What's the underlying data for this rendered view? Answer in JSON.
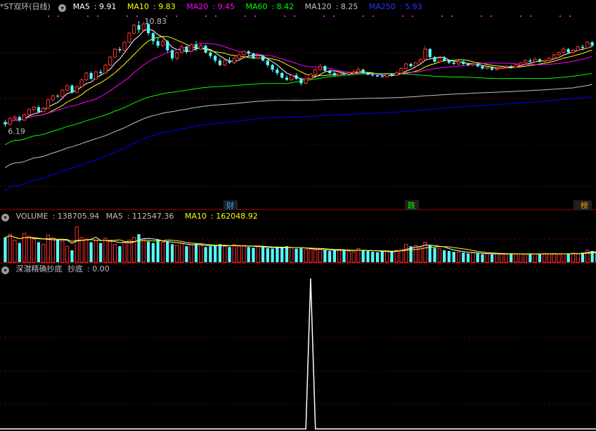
{
  "panels": {
    "price": {
      "title": "*ST双环(日线)",
      "ma_labels": [
        {
          "name": "MA5",
          "value": "9.91",
          "color": "#ffffff"
        },
        {
          "name": "MA10",
          "value": "9.83",
          "color": "#ffff00"
        },
        {
          "name": "MA20",
          "value": "9.45",
          "color": "#ff00ff"
        },
        {
          "name": "MA60",
          "value": "8.42",
          "color": "#00ff00"
        },
        {
          "name": "MA120",
          "value": "8.25",
          "color": "#c0c0c0"
        },
        {
          "name": "MA250",
          "value": "5.93",
          "color": "#0000ff"
        }
      ],
      "high_label": "10.83",
      "low_label": "6.19",
      "event_markers": [
        {
          "text": "财",
          "color": "#3399ff"
        },
        {
          "text": "跌",
          "color": "#00ff00"
        },
        {
          "text": "榜",
          "color": "#ff9900"
        }
      ]
    },
    "volume": {
      "title": "VOLUME",
      "value": "138705.94",
      "ma5_label": "MA5",
      "ma5_value": "112547.36",
      "ma10_label": "MA10",
      "ma10_value": "162048.92"
    },
    "indicator": {
      "title": "深潜精确抄底",
      "series_label": "抄底",
      "value": "0.00"
    }
  },
  "colors": {
    "up": "#ff3232",
    "down": "#54ffff",
    "grid": "#7a0000",
    "separator": "#b00000",
    "ma5": "#ffffff",
    "ma10": "#ffff00",
    "ma20": "#ff00ff",
    "ma60": "#00ff00",
    "ma120": "#c0c0c0",
    "ma250": "#0000ff",
    "indicator_line": "#ffffff"
  },
  "chart_data": {
    "type": "candlestick",
    "price_range": [
      5.8,
      11.2
    ],
    "candles": [
      [
        6.4,
        6.3,
        6.19,
        6.5
      ],
      [
        6.3,
        6.55,
        6.25,
        6.62
      ],
      [
        6.55,
        6.62,
        6.48,
        6.7
      ],
      [
        6.62,
        6.48,
        6.4,
        6.68
      ],
      [
        6.48,
        6.72,
        6.45,
        6.78
      ],
      [
        6.72,
        6.95,
        6.7,
        7.0
      ],
      [
        6.95,
        7.05,
        6.88,
        7.1
      ],
      [
        7.05,
        6.85,
        6.8,
        7.12
      ],
      [
        6.85,
        7.0,
        6.82,
        7.08
      ],
      [
        7.0,
        7.38,
        6.98,
        7.42
      ],
      [
        7.38,
        7.55,
        7.3,
        7.6
      ],
      [
        7.55,
        7.52,
        7.45,
        7.62
      ],
      [
        7.52,
        7.8,
        7.5,
        7.85
      ],
      [
        7.8,
        8.0,
        7.75,
        8.05
      ],
      [
        8.0,
        7.7,
        7.65,
        8.05
      ],
      [
        7.7,
        7.95,
        7.68,
        8.0
      ],
      [
        7.95,
        8.25,
        7.9,
        8.3
      ],
      [
        8.25,
        8.55,
        8.2,
        8.6
      ],
      [
        8.55,
        8.3,
        8.25,
        8.62
      ],
      [
        8.3,
        8.6,
        8.28,
        8.65
      ],
      [
        8.6,
        8.55,
        8.45,
        8.7
      ],
      [
        8.55,
        8.9,
        8.5,
        8.95
      ],
      [
        8.9,
        9.25,
        8.85,
        9.3
      ],
      [
        9.25,
        9.6,
        9.2,
        9.65
      ],
      [
        9.6,
        9.55,
        9.45,
        9.7
      ],
      [
        9.55,
        9.9,
        9.5,
        9.95
      ],
      [
        9.9,
        10.3,
        9.85,
        10.35
      ],
      [
        10.3,
        10.65,
        10.25,
        10.7
      ],
      [
        10.65,
        10.45,
        10.3,
        10.83
      ],
      [
        10.45,
        10.7,
        10.4,
        10.8
      ],
      [
        10.7,
        10.3,
        10.2,
        10.75
      ],
      [
        10.3,
        9.95,
        9.8,
        10.35
      ],
      [
        9.95,
        9.75,
        9.65,
        10.1
      ],
      [
        9.75,
        9.95,
        9.7,
        10.05
      ],
      [
        9.95,
        9.55,
        9.45,
        10.0
      ],
      [
        9.55,
        9.2,
        9.1,
        9.6
      ],
      [
        9.2,
        9.45,
        9.1,
        9.5
      ],
      [
        9.45,
        9.7,
        9.4,
        9.8
      ],
      [
        9.7,
        9.5,
        9.4,
        9.75
      ],
      [
        9.5,
        9.8,
        9.45,
        9.85
      ],
      [
        9.8,
        9.6,
        9.5,
        9.95
      ],
      [
        9.6,
        9.75,
        9.55,
        9.85
      ],
      [
        9.75,
        9.45,
        9.4,
        9.8
      ],
      [
        9.45,
        9.3,
        9.2,
        9.5
      ],
      [
        9.3,
        9.1,
        9.0,
        9.35
      ],
      [
        9.1,
        8.9,
        8.85,
        9.2
      ],
      [
        8.9,
        9.1,
        8.85,
        9.15
      ],
      [
        9.1,
        9.0,
        8.95,
        9.25
      ],
      [
        9.0,
        9.2,
        8.95,
        9.3
      ],
      [
        9.2,
        9.35,
        9.15,
        9.45
      ],
      [
        9.35,
        9.5,
        9.3,
        9.55
      ],
      [
        9.5,
        9.4,
        9.3,
        9.55
      ],
      [
        9.4,
        9.2,
        9.15,
        9.45
      ],
      [
        9.2,
        9.3,
        9.15,
        9.35
      ],
      [
        9.3,
        9.1,
        9.05,
        9.35
      ],
      [
        9.1,
        8.9,
        8.8,
        9.15
      ],
      [
        8.9,
        8.7,
        8.6,
        8.95
      ],
      [
        8.7,
        8.55,
        8.45,
        8.8
      ],
      [
        8.55,
        8.35,
        8.3,
        8.6
      ],
      [
        8.35,
        8.25,
        8.2,
        8.45
      ],
      [
        8.25,
        8.45,
        8.2,
        8.5
      ],
      [
        8.45,
        8.3,
        8.25,
        8.55
      ],
      [
        8.3,
        8.1,
        8.0,
        8.35
      ],
      [
        8.1,
        8.3,
        8.05,
        8.4
      ],
      [
        8.3,
        8.5,
        8.25,
        8.55
      ],
      [
        8.5,
        8.7,
        8.45,
        8.75
      ],
      [
        8.7,
        8.85,
        8.65,
        8.95
      ],
      [
        8.85,
        8.65,
        8.6,
        8.9
      ],
      [
        8.65,
        8.55,
        8.5,
        8.7
      ],
      [
        8.55,
        8.45,
        8.4,
        8.6
      ],
      [
        8.45,
        8.55,
        8.4,
        8.62
      ],
      [
        8.55,
        8.5,
        8.45,
        8.6
      ],
      [
        8.5,
        8.55,
        8.48,
        8.62
      ],
      [
        8.55,
        8.6,
        8.5,
        8.7
      ],
      [
        8.6,
        8.7,
        8.55,
        8.8
      ],
      [
        8.7,
        8.55,
        8.5,
        8.75
      ],
      [
        8.55,
        8.48,
        8.45,
        8.6
      ],
      [
        8.48,
        8.45,
        8.4,
        8.52
      ],
      [
        8.45,
        8.4,
        8.38,
        8.5
      ],
      [
        8.4,
        8.38,
        8.35,
        8.45
      ],
      [
        8.38,
        8.5,
        8.35,
        8.55
      ],
      [
        8.5,
        8.45,
        8.4,
        8.55
      ],
      [
        8.45,
        8.55,
        8.42,
        8.65
      ],
      [
        8.55,
        8.75,
        8.5,
        8.8
      ],
      [
        8.75,
        8.95,
        8.7,
        9.0
      ],
      [
        8.95,
        8.85,
        8.8,
        9.0
      ],
      [
        8.85,
        9.0,
        8.8,
        9.05
      ],
      [
        9.0,
        9.15,
        8.95,
        9.2
      ],
      [
        9.15,
        9.6,
        9.1,
        9.75
      ],
      [
        9.6,
        9.25,
        9.15,
        9.65
      ],
      [
        9.25,
        9.05,
        9.0,
        9.3
      ],
      [
        9.05,
        9.2,
        9.0,
        9.25
      ],
      [
        9.2,
        9.1,
        9.05,
        9.3
      ],
      [
        9.1,
        9.0,
        8.95,
        9.15
      ],
      [
        9.0,
        8.95,
        8.9,
        9.1
      ],
      [
        8.95,
        9.05,
        8.9,
        9.1
      ],
      [
        9.05,
        8.95,
        8.9,
        9.1
      ],
      [
        8.95,
        8.9,
        8.85,
        9.0
      ],
      [
        8.9,
        8.95,
        8.85,
        9.0
      ],
      [
        8.95,
        8.85,
        8.8,
        9.0
      ],
      [
        8.85,
        8.75,
        8.7,
        8.9
      ],
      [
        8.75,
        8.8,
        8.7,
        8.85
      ],
      [
        8.8,
        8.7,
        8.65,
        8.85
      ],
      [
        8.7,
        8.75,
        8.65,
        8.8
      ],
      [
        8.75,
        8.8,
        8.7,
        8.85
      ],
      [
        8.8,
        8.85,
        8.75,
        8.9
      ],
      [
        8.85,
        8.8,
        8.75,
        8.9
      ],
      [
        8.8,
        8.9,
        8.75,
        8.95
      ],
      [
        8.9,
        9.0,
        8.85,
        9.05
      ],
      [
        9.0,
        9.1,
        8.95,
        9.15
      ],
      [
        9.1,
        9.05,
        9.0,
        9.2
      ],
      [
        9.05,
        9.15,
        9.0,
        9.25
      ],
      [
        9.15,
        9.05,
        9.0,
        9.2
      ],
      [
        9.05,
        9.1,
        9.0,
        9.15
      ],
      [
        9.1,
        9.2,
        9.05,
        9.25
      ],
      [
        9.2,
        9.35,
        9.15,
        9.4
      ],
      [
        9.35,
        9.45,
        9.3,
        9.5
      ],
      [
        9.45,
        9.6,
        9.4,
        9.7
      ],
      [
        9.6,
        9.45,
        9.4,
        9.65
      ],
      [
        9.45,
        9.55,
        9.4,
        9.6
      ],
      [
        9.55,
        9.7,
        9.5,
        9.75
      ],
      [
        9.7,
        9.65,
        9.55,
        9.8
      ],
      [
        9.65,
        9.9,
        9.6,
        9.95
      ],
      [
        9.9,
        9.75,
        9.7,
        9.95
      ]
    ],
    "volume": [
      0.62,
      0.7,
      0.55,
      0.48,
      0.72,
      0.65,
      0.58,
      0.5,
      0.45,
      0.68,
      0.6,
      0.55,
      0.52,
      0.4,
      0.3,
      0.88,
      0.62,
      0.58,
      0.5,
      0.55,
      0.48,
      0.6,
      0.52,
      0.45,
      0.4,
      0.5,
      0.55,
      0.62,
      0.7,
      0.58,
      0.52,
      0.48,
      0.56,
      0.5,
      0.52,
      0.45,
      0.42,
      0.48,
      0.4,
      0.44,
      0.46,
      0.42,
      0.38,
      0.4,
      0.42,
      0.45,
      0.4,
      0.38,
      0.44,
      0.4,
      0.42,
      0.38,
      0.36,
      0.4,
      0.38,
      0.35,
      0.34,
      0.36,
      0.38,
      0.4,
      0.36,
      0.34,
      0.35,
      0.32,
      0.33,
      0.3,
      0.32,
      0.3,
      0.28,
      0.3,
      0.32,
      0.3,
      0.28,
      0.26,
      0.34,
      0.3,
      0.28,
      0.26,
      0.25,
      0.27,
      0.28,
      0.26,
      0.3,
      0.32,
      0.45,
      0.4,
      0.42,
      0.38,
      0.5,
      0.42,
      0.36,
      0.34,
      0.3,
      0.28,
      0.26,
      0.25,
      0.24,
      0.22,
      0.24,
      0.22,
      0.2,
      0.21,
      0.2,
      0.22,
      0.21,
      0.2,
      0.22,
      0.2,
      0.21,
      0.2,
      0.22,
      0.21,
      0.2,
      0.22,
      0.21,
      0.22,
      0.2,
      0.21,
      0.22,
      0.23,
      0.22,
      0.24,
      0.3,
      0.28,
      0.26,
      0.25,
      0.24,
      0.4
    ],
    "indicator": {
      "spike_index": 64,
      "values_max": 1.0
    }
  }
}
